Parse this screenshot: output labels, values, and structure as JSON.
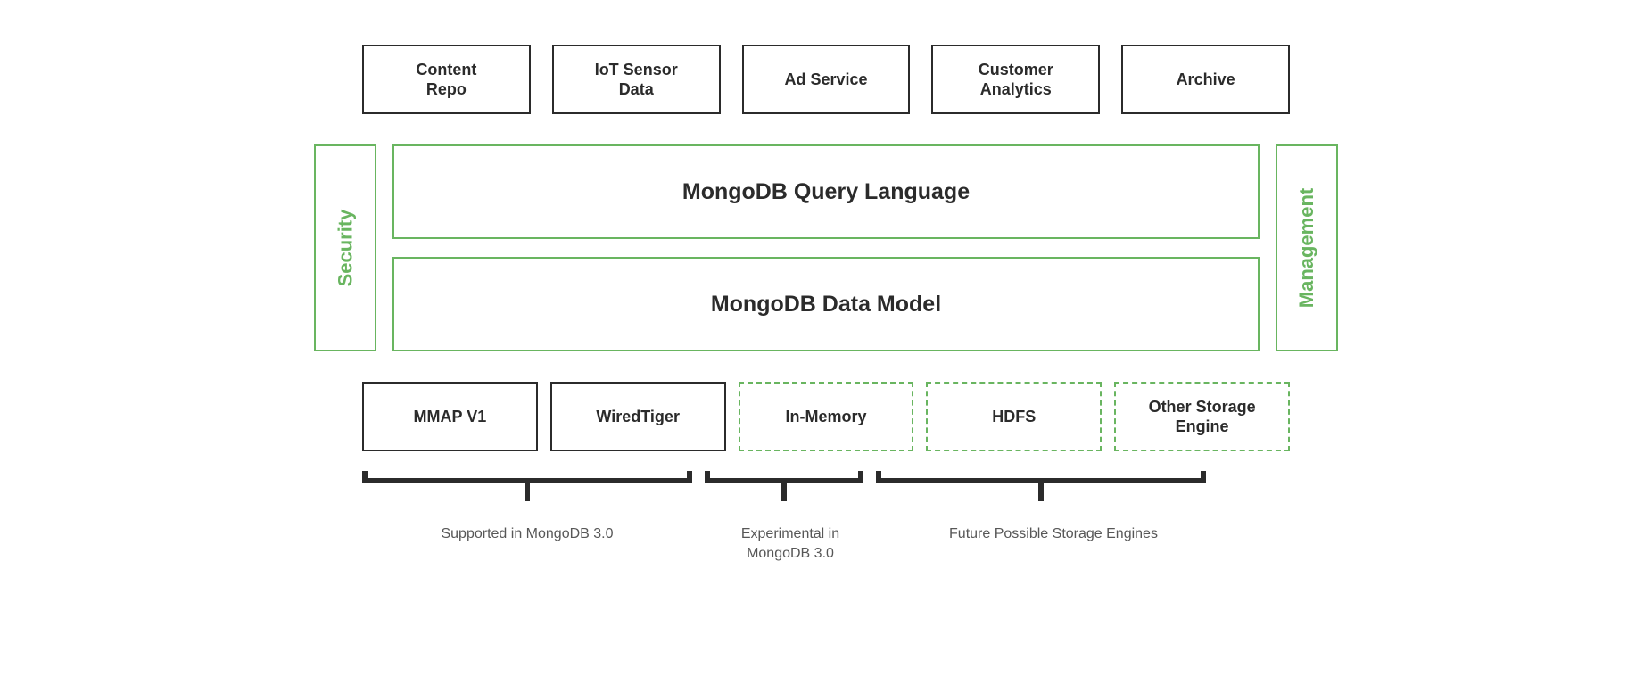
{
  "apps": [
    {
      "label": "Content\nRepo"
    },
    {
      "label": "IoT Sensor\nData"
    },
    {
      "label": "Ad Service"
    },
    {
      "label": "Customer\nAnalytics"
    },
    {
      "label": "Archive"
    }
  ],
  "side": {
    "left": "Security",
    "right": "Management"
  },
  "layers": {
    "query": "MongoDB Query Language",
    "model": "MongoDB Data Model"
  },
  "engines": [
    {
      "label": "MMAP V1",
      "style": "solid"
    },
    {
      "label": "WiredTiger",
      "style": "solid"
    },
    {
      "label": "In-Memory",
      "style": "dashed"
    },
    {
      "label": "HDFS",
      "style": "dashed"
    },
    {
      "label": "Other Storage\nEngine",
      "style": "dashed"
    }
  ],
  "captions": {
    "supported": "Supported in MongoDB 3.0",
    "experimental": "Experimental in\nMongoDB 3.0",
    "future": "Future Possible Storage Engines"
  },
  "colors": {
    "accent": "#69b560",
    "text": "#2b2b2b"
  }
}
